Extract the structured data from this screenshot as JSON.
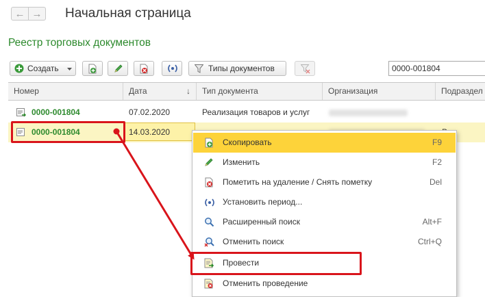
{
  "header": {
    "back_label": "←",
    "forward_label": "→",
    "title": "Начальная страница"
  },
  "section": {
    "title": "Реестр торговых документов"
  },
  "toolbar": {
    "create_label": "Создать",
    "doc_types_label": "Типы документов",
    "search_value": "0000-001804"
  },
  "table": {
    "columns": [
      "Номер",
      "Дата",
      "Тип документа",
      "Организация",
      "Подраздел"
    ],
    "sort_indicator": "↓",
    "rows": [
      {
        "number": "0000-001804",
        "date": "07.02.2020",
        "type": "Реализация товаров и услуг",
        "division": ""
      },
      {
        "number": "0000-001804",
        "date": "14.03.2020",
        "type": "",
        "division": "Рэ"
      }
    ]
  },
  "context_menu": {
    "items": [
      {
        "label": "Скопировать",
        "shortcut": "F9",
        "icon": "copy-icon"
      },
      {
        "label": "Изменить",
        "shortcut": "F2",
        "icon": "pencil-icon"
      },
      {
        "label": "Пометить на удаление / Снять пометку",
        "shortcut": "Del",
        "icon": "delete-mark-icon"
      },
      {
        "label": "Установить период...",
        "shortcut": "",
        "icon": "period-icon"
      },
      {
        "label": "Расширенный поиск",
        "shortcut": "Alt+F",
        "icon": "advanced-search-icon"
      },
      {
        "label": "Отменить поиск",
        "shortcut": "Ctrl+Q",
        "icon": "cancel-search-icon"
      },
      {
        "label": "Провести",
        "shortcut": "",
        "icon": "post-document-icon"
      },
      {
        "label": "Отменить проведение",
        "shortcut": "",
        "icon": "unpost-document-icon"
      }
    ]
  },
  "colors": {
    "accent_green": "#2d8a2d",
    "highlight_yellow": "#fdd33a",
    "selected_row": "#fbf5c3",
    "annotation_red": "#d9141b"
  }
}
